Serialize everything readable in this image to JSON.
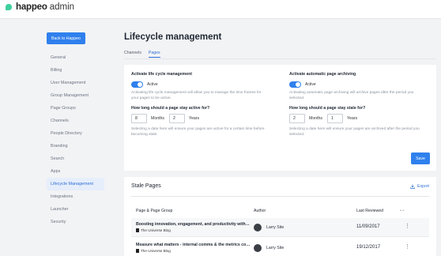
{
  "app": {
    "brand": "happeo",
    "product": "admin"
  },
  "back_button": "Back to Happeo",
  "sidebar": {
    "items": [
      {
        "label": "General"
      },
      {
        "label": "Billing"
      },
      {
        "label": "User Management"
      },
      {
        "label": "Group Management"
      },
      {
        "label": "Page Groups"
      },
      {
        "label": "Channels"
      },
      {
        "label": "People Directory"
      },
      {
        "label": "Branding"
      },
      {
        "label": "Search"
      },
      {
        "label": "Apps"
      },
      {
        "label": "Lifecycle Management",
        "active": true
      },
      {
        "label": "Integrations"
      },
      {
        "label": "Launcher"
      },
      {
        "label": "Security"
      }
    ]
  },
  "main": {
    "title": "Lifecycle management",
    "tabs": [
      {
        "label": "Channels"
      },
      {
        "label": "Pages",
        "active": true
      }
    ]
  },
  "settings": {
    "lifecycle": {
      "label": "Activate life cycle management",
      "toggle_text": "Active",
      "help": "Activating life cycle management will allow you to manage the time frames for your pages to be active.",
      "question": "How long should a page stay active for?",
      "months_value": "8",
      "months_label": "Months",
      "years_value": "2",
      "years_label": "Years",
      "help2": "Selecting a date here will ensure your pages are active for a certain time before becoming stale."
    },
    "archiving": {
      "label": "Activate automatic page archiving",
      "toggle_text": "Active",
      "help": "Activating automatic page archiving will archive pages after the period you selected.",
      "question": "How long should a page stay stale for?",
      "months_value": "2",
      "months_label": "Months",
      "years_value": "1",
      "years_label": "Years",
      "help2": "Selecting a date here will ensure your pages are archived after the period you selected."
    },
    "save_label": "Save"
  },
  "stale": {
    "title": "Stale Pages",
    "export_label": "Export",
    "headers": {
      "page": "Page & Page Group",
      "author": "Author",
      "review": "Last Reviewed",
      "dots": "•  •"
    },
    "rows": [
      {
        "title": "Boosting innovation, engagement, and productivity with cro...",
        "source": "The Universe Blog",
        "author": "Larry Site",
        "date": "11/09/2017"
      },
      {
        "title": "Measure what matters - internal comms & the metrics consu...",
        "source": "The Universe Blog",
        "author": "Larry Site",
        "date": "19/12/2017"
      }
    ]
  },
  "colors": {
    "accent": "#2f80ed",
    "logo": "#3ecf9f",
    "active_nav_bg": "#e6eefb"
  }
}
